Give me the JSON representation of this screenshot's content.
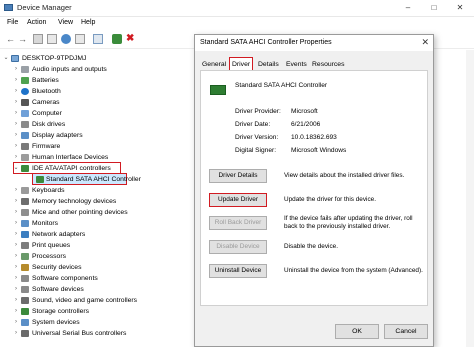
{
  "window": {
    "title": "Device Manager"
  },
  "menu": [
    "File",
    "Action",
    "View",
    "Help"
  ],
  "tree": {
    "root": "DESKTOP-9TPDJMJ",
    "items": [
      "Audio inputs and outputs",
      "Batteries",
      "Bluetooth",
      "Cameras",
      "Computer",
      "Disk drives",
      "Display adapters",
      "Firmware",
      "Human Interface Devices",
      "IDE ATA/ATAPI controllers",
      "Standard SATA AHCI Controller",
      "Keyboards",
      "Memory technology devices",
      "Mice and other pointing devices",
      "Monitors",
      "Network adapters",
      "Print queues",
      "Processors",
      "Security devices",
      "Software components",
      "Software devices",
      "Sound, video and game controllers",
      "Storage controllers",
      "System devices",
      "Universal Serial Bus controllers"
    ]
  },
  "dialog": {
    "title": "Standard SATA AHCI Controller Properties",
    "tabs": [
      "General",
      "Driver",
      "Details",
      "Events",
      "Resources"
    ],
    "device_name": "Standard SATA AHCI Controller",
    "fields": [
      {
        "label": "Driver Provider:",
        "value": "Microsoft"
      },
      {
        "label": "Driver Date:",
        "value": "6/21/2006"
      },
      {
        "label": "Driver Version:",
        "value": "10.0.18362.693"
      },
      {
        "label": "Digital Signer:",
        "value": "Microsoft Windows"
      }
    ],
    "buttons": [
      {
        "label": "Driver Details",
        "desc": "View details about the installed driver files."
      },
      {
        "label": "Update Driver",
        "desc": "Update the driver for this device."
      },
      {
        "label": "Roll Back Driver",
        "desc": "If the device fails after updating the driver, roll back to the previously installed driver."
      },
      {
        "label": "Disable Device",
        "desc": "Disable the device."
      },
      {
        "label": "Uninstall Device",
        "desc": "Uninstall the device from the system (Advanced)."
      }
    ],
    "ok": "OK",
    "cancel": "Cancel"
  },
  "colors": {
    "highlight": "#d11b22",
    "selected_bg": "#cce8ff"
  }
}
